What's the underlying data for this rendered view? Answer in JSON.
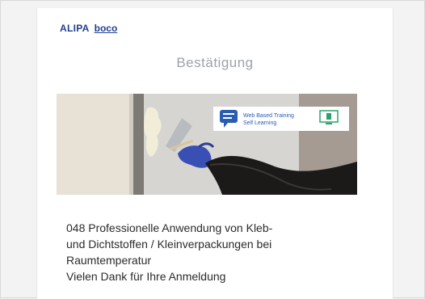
{
  "brand": {
    "logo_left": "ALIPA",
    "logo_right": "boco"
  },
  "page": {
    "title": "Bestätigung"
  },
  "hero_badge": {
    "line1": "Web Based Training",
    "line2": "Self Learning",
    "accent_color": "#2aa36b"
  },
  "course": {
    "name_lines": [
      "048 Professionelle Anwendung von Kleb-",
      "und Dichtstoffen / Kleinverpackungen bei",
      "Raumtemperatur"
    ],
    "thanks": "Vielen Dank für Ihre Anmeldung"
  },
  "colors": {
    "brand_blue": "#1f3f8f",
    "title_gray": "#9ea3a7"
  }
}
